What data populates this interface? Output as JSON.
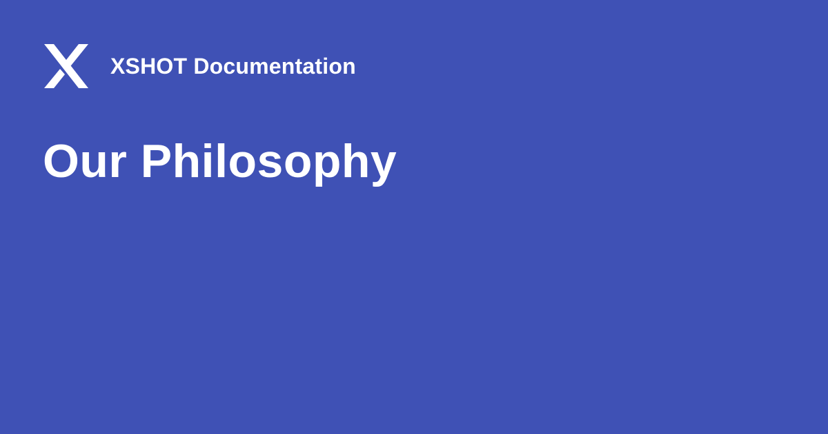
{
  "colors": {
    "background": "#3f51b5",
    "text": "#ffffff"
  },
  "brand": {
    "logo_icon": "xshot-logo-icon",
    "site_name": "XSHOT Documentation"
  },
  "page": {
    "title": "Our Philosophy"
  }
}
